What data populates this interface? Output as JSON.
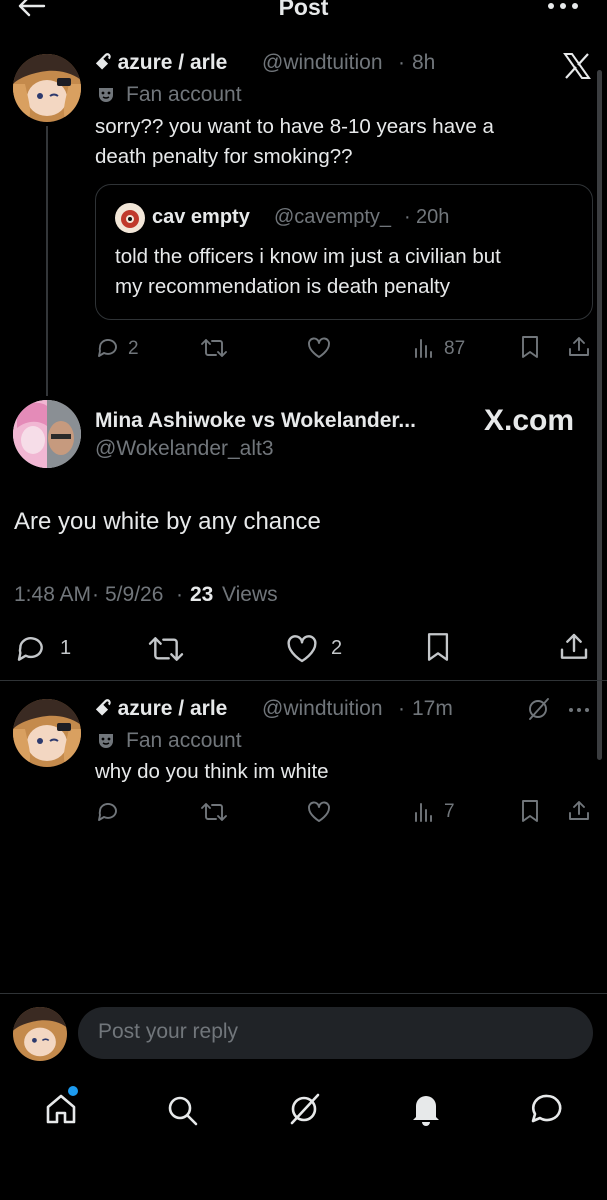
{
  "header": {
    "title": "Post"
  },
  "main_post": {
    "name": "ꗃ azure / arle",
    "handle": "@windtuition",
    "time": "8h",
    "label": "Fan account",
    "text_line1": "sorry?? you want to have 8-10 years have a",
    "text_line2": "death penalty for smoking??",
    "quote": {
      "name": "cav empty",
      "handle": "@cavempty_",
      "time": "20h",
      "text_line1": "told the officers i know im just a civilian but",
      "text_line2": "my recommendation is death penalty"
    },
    "replies": "2",
    "views": "87"
  },
  "focus_post": {
    "name": "Mina Ashiwoke vs Wokelander...",
    "handle": "@Wokelander_alt3",
    "watermark": "X.com",
    "text": "Are you white by any chance",
    "time": "1:48 AM",
    "date": "5/9/26",
    "views_count": "23",
    "views_label": "Views",
    "replies": "1",
    "likes": "2"
  },
  "reply_post": {
    "name": "ꗃ azure / arle",
    "handle": "@windtuition",
    "time": "17m",
    "label": "Fan account",
    "text": "why do you think im white",
    "views": "7"
  },
  "composer": {
    "placeholder": "Post your reply"
  },
  "colors": {
    "background": "#000000",
    "text": "#e7e9ea",
    "muted": "#71767b",
    "notification_dot": "#1d9bf0"
  },
  "icons": [
    "back-arrow-icon",
    "more-icon",
    "x-logo-icon",
    "theater-mask-icon",
    "reply-icon",
    "repost-icon",
    "like-icon",
    "views-icon",
    "bookmark-icon",
    "share-icon",
    "grok-icon",
    "home-icon",
    "search-icon",
    "notifications-icon",
    "messages-icon"
  ]
}
